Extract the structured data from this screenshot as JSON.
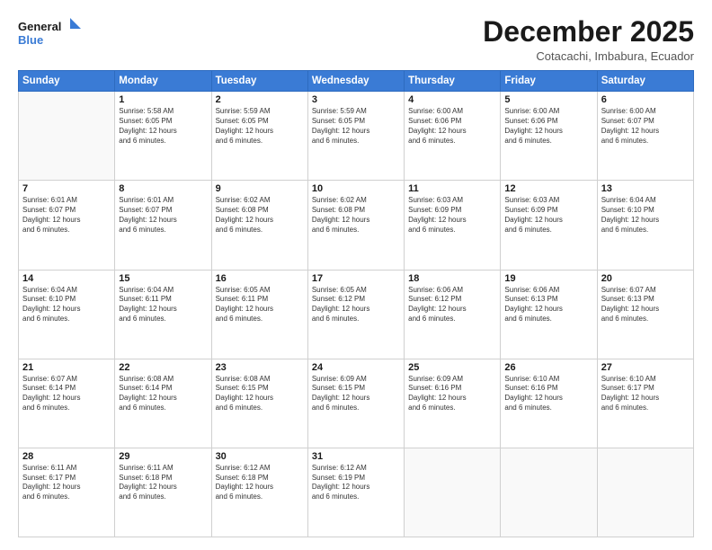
{
  "logo": {
    "line1": "General",
    "line2": "Blue"
  },
  "title": "December 2025",
  "subtitle": "Cotacachi, Imbabura, Ecuador",
  "weekdays": [
    "Sunday",
    "Monday",
    "Tuesday",
    "Wednesday",
    "Thursday",
    "Friday",
    "Saturday"
  ],
  "weeks": [
    [
      {
        "day": "",
        "info": ""
      },
      {
        "day": "1",
        "info": "Sunrise: 5:58 AM\nSunset: 6:05 PM\nDaylight: 12 hours\nand 6 minutes."
      },
      {
        "day": "2",
        "info": "Sunrise: 5:59 AM\nSunset: 6:05 PM\nDaylight: 12 hours\nand 6 minutes."
      },
      {
        "day": "3",
        "info": "Sunrise: 5:59 AM\nSunset: 6:05 PM\nDaylight: 12 hours\nand 6 minutes."
      },
      {
        "day": "4",
        "info": "Sunrise: 6:00 AM\nSunset: 6:06 PM\nDaylight: 12 hours\nand 6 minutes."
      },
      {
        "day": "5",
        "info": "Sunrise: 6:00 AM\nSunset: 6:06 PM\nDaylight: 12 hours\nand 6 minutes."
      },
      {
        "day": "6",
        "info": "Sunrise: 6:00 AM\nSunset: 6:07 PM\nDaylight: 12 hours\nand 6 minutes."
      }
    ],
    [
      {
        "day": "7",
        "info": "Sunrise: 6:01 AM\nSunset: 6:07 PM\nDaylight: 12 hours\nand 6 minutes."
      },
      {
        "day": "8",
        "info": "Sunrise: 6:01 AM\nSunset: 6:07 PM\nDaylight: 12 hours\nand 6 minutes."
      },
      {
        "day": "9",
        "info": "Sunrise: 6:02 AM\nSunset: 6:08 PM\nDaylight: 12 hours\nand 6 minutes."
      },
      {
        "day": "10",
        "info": "Sunrise: 6:02 AM\nSunset: 6:08 PM\nDaylight: 12 hours\nand 6 minutes."
      },
      {
        "day": "11",
        "info": "Sunrise: 6:03 AM\nSunset: 6:09 PM\nDaylight: 12 hours\nand 6 minutes."
      },
      {
        "day": "12",
        "info": "Sunrise: 6:03 AM\nSunset: 6:09 PM\nDaylight: 12 hours\nand 6 minutes."
      },
      {
        "day": "13",
        "info": "Sunrise: 6:04 AM\nSunset: 6:10 PM\nDaylight: 12 hours\nand 6 minutes."
      }
    ],
    [
      {
        "day": "14",
        "info": "Sunrise: 6:04 AM\nSunset: 6:10 PM\nDaylight: 12 hours\nand 6 minutes."
      },
      {
        "day": "15",
        "info": "Sunrise: 6:04 AM\nSunset: 6:11 PM\nDaylight: 12 hours\nand 6 minutes."
      },
      {
        "day": "16",
        "info": "Sunrise: 6:05 AM\nSunset: 6:11 PM\nDaylight: 12 hours\nand 6 minutes."
      },
      {
        "day": "17",
        "info": "Sunrise: 6:05 AM\nSunset: 6:12 PM\nDaylight: 12 hours\nand 6 minutes."
      },
      {
        "day": "18",
        "info": "Sunrise: 6:06 AM\nSunset: 6:12 PM\nDaylight: 12 hours\nand 6 minutes."
      },
      {
        "day": "19",
        "info": "Sunrise: 6:06 AM\nSunset: 6:13 PM\nDaylight: 12 hours\nand 6 minutes."
      },
      {
        "day": "20",
        "info": "Sunrise: 6:07 AM\nSunset: 6:13 PM\nDaylight: 12 hours\nand 6 minutes."
      }
    ],
    [
      {
        "day": "21",
        "info": "Sunrise: 6:07 AM\nSunset: 6:14 PM\nDaylight: 12 hours\nand 6 minutes."
      },
      {
        "day": "22",
        "info": "Sunrise: 6:08 AM\nSunset: 6:14 PM\nDaylight: 12 hours\nand 6 minutes."
      },
      {
        "day": "23",
        "info": "Sunrise: 6:08 AM\nSunset: 6:15 PM\nDaylight: 12 hours\nand 6 minutes."
      },
      {
        "day": "24",
        "info": "Sunrise: 6:09 AM\nSunset: 6:15 PM\nDaylight: 12 hours\nand 6 minutes."
      },
      {
        "day": "25",
        "info": "Sunrise: 6:09 AM\nSunset: 6:16 PM\nDaylight: 12 hours\nand 6 minutes."
      },
      {
        "day": "26",
        "info": "Sunrise: 6:10 AM\nSunset: 6:16 PM\nDaylight: 12 hours\nand 6 minutes."
      },
      {
        "day": "27",
        "info": "Sunrise: 6:10 AM\nSunset: 6:17 PM\nDaylight: 12 hours\nand 6 minutes."
      }
    ],
    [
      {
        "day": "28",
        "info": "Sunrise: 6:11 AM\nSunset: 6:17 PM\nDaylight: 12 hours\nand 6 minutes."
      },
      {
        "day": "29",
        "info": "Sunrise: 6:11 AM\nSunset: 6:18 PM\nDaylight: 12 hours\nand 6 minutes."
      },
      {
        "day": "30",
        "info": "Sunrise: 6:12 AM\nSunset: 6:18 PM\nDaylight: 12 hours\nand 6 minutes."
      },
      {
        "day": "31",
        "info": "Sunrise: 6:12 AM\nSunset: 6:19 PM\nDaylight: 12 hours\nand 6 minutes."
      },
      {
        "day": "",
        "info": ""
      },
      {
        "day": "",
        "info": ""
      },
      {
        "day": "",
        "info": ""
      }
    ]
  ]
}
